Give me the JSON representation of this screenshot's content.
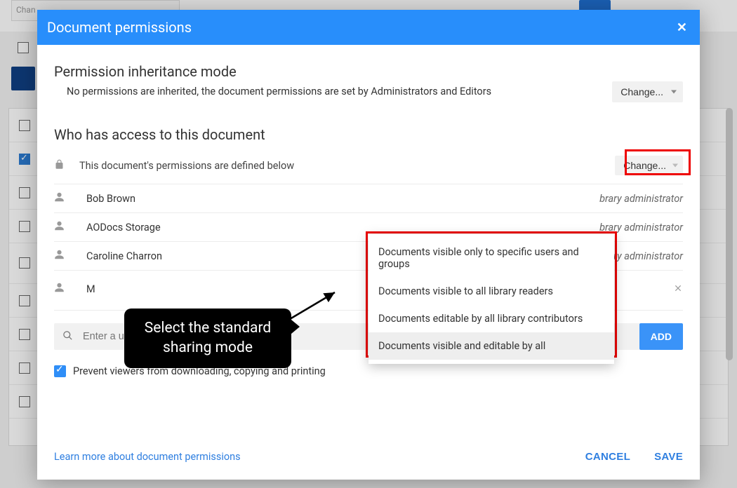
{
  "colors": {
    "primary": "#288efb",
    "danger_outline": "#e00"
  },
  "bg": {
    "change_label": "Chan",
    "rows": [
      {
        "checked": false
      },
      {
        "checked": true
      },
      {
        "checked": false
      },
      {
        "checked": false
      },
      {
        "checked": false
      },
      {
        "checked": false
      },
      {
        "checked": false
      },
      {
        "checked": false
      },
      {
        "checked": false
      }
    ]
  },
  "modal": {
    "title": "Document permissions",
    "close_label": "✕",
    "inheritance": {
      "heading": "Permission inheritance mode",
      "description": "No permissions are inherited, the document permissions are set by Administrators and Editors",
      "change_label": "Change..."
    },
    "access": {
      "heading": "Who has access to this document",
      "locked_text": "This document's permissions are defined below",
      "change_label": "Change..."
    },
    "users": [
      {
        "name": "Bob Brown",
        "role": "brary administrator",
        "removable": false
      },
      {
        "name": "AODocs Storage",
        "role": "brary administrator",
        "removable": false
      },
      {
        "name": "Caroline Charron",
        "role": "brary administrator",
        "removable": false
      },
      {
        "name": "M",
        "role": "",
        "removable": true
      }
    ],
    "dropdown_options": [
      "Documents visible only to specific users and groups",
      "Documents visible to all library readers",
      "Documents editable by all library contributors",
      "Documents visible and editable by all"
    ],
    "dropdown_selected_index": 3,
    "add_user": {
      "placeholder": "Enter a user or group to add permissions",
      "add_label": "ADD"
    },
    "prevent_label": "Prevent viewers from downloading, copying and printing",
    "learn_more": "Learn more about document permissions",
    "cancel": "CANCEL",
    "save": "SAVE"
  },
  "callout": {
    "line1": "Select the standard",
    "line2": "sharing mode"
  }
}
